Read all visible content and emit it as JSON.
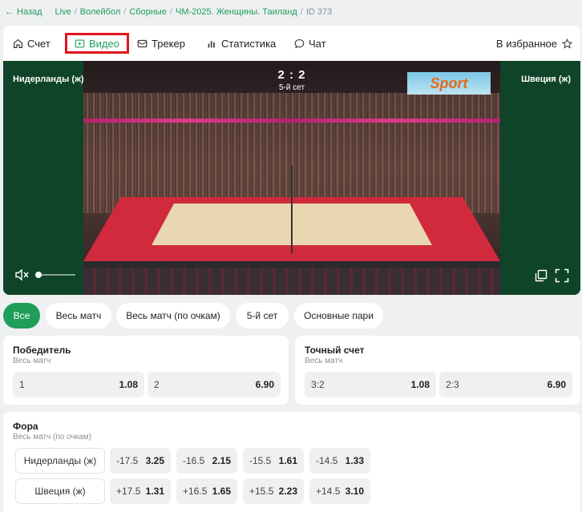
{
  "breadcrumb": {
    "back_label": "Назад",
    "items": [
      "Live",
      "Волейбол",
      "Сборные",
      "ЧМ-2025. Женщины. Таиланд"
    ],
    "id_label": "ID 373"
  },
  "tabs": [
    {
      "label": "Счет",
      "icon": "home-icon"
    },
    {
      "label": "Видео",
      "icon": "play-icon",
      "active": true
    },
    {
      "label": "Трекер",
      "icon": "tracker-icon"
    },
    {
      "label": "Статистика",
      "icon": "bar-chart-icon"
    },
    {
      "label": "Чат",
      "icon": "chat-icon"
    }
  ],
  "favorites_label": "В избранное",
  "video": {
    "team_left": "Нидерланды (ж)",
    "team_right": "Швеция (ж)",
    "score": "2 : 2",
    "set_label": "5-й сет",
    "logo_text": "Sport",
    "volume_level": 0.05
  },
  "filters": [
    "Все",
    "Весь матч",
    "Весь матч (по очкам)",
    "5-й сет",
    "Основные пари"
  ],
  "markets": {
    "winner": {
      "title": "Победитель",
      "subtitle": "Весь матч",
      "odds": [
        {
          "label": "1",
          "value": "1.08"
        },
        {
          "label": "2",
          "value": "6.90"
        }
      ]
    },
    "exact_score": {
      "title": "Точный счет",
      "subtitle": "Весь матч",
      "odds": [
        {
          "label": "3:2",
          "value": "1.08"
        },
        {
          "label": "2:3",
          "value": "6.90"
        }
      ]
    },
    "handicap": {
      "title": "Фора",
      "subtitle": "Весь матч (по очкам)",
      "rows": [
        {
          "team": "Нидерланды (ж)",
          "odds": [
            {
              "label": "-17.5",
              "value": "3.25"
            },
            {
              "label": "-16.5",
              "value": "2.15"
            },
            {
              "label": "-15.5",
              "value": "1.61"
            },
            {
              "label": "-14.5",
              "value": "1.33"
            }
          ]
        },
        {
          "team": "Швеция (ж)",
          "odds": [
            {
              "label": "+17.5",
              "value": "1.31"
            },
            {
              "label": "+16.5",
              "value": "1.65"
            },
            {
              "label": "+15.5",
              "value": "2.23"
            },
            {
              "label": "+14.5",
              "value": "3.10"
            }
          ]
        }
      ]
    }
  },
  "colors": {
    "accent": "#1e9e5a",
    "highlight": "#e0141e"
  }
}
